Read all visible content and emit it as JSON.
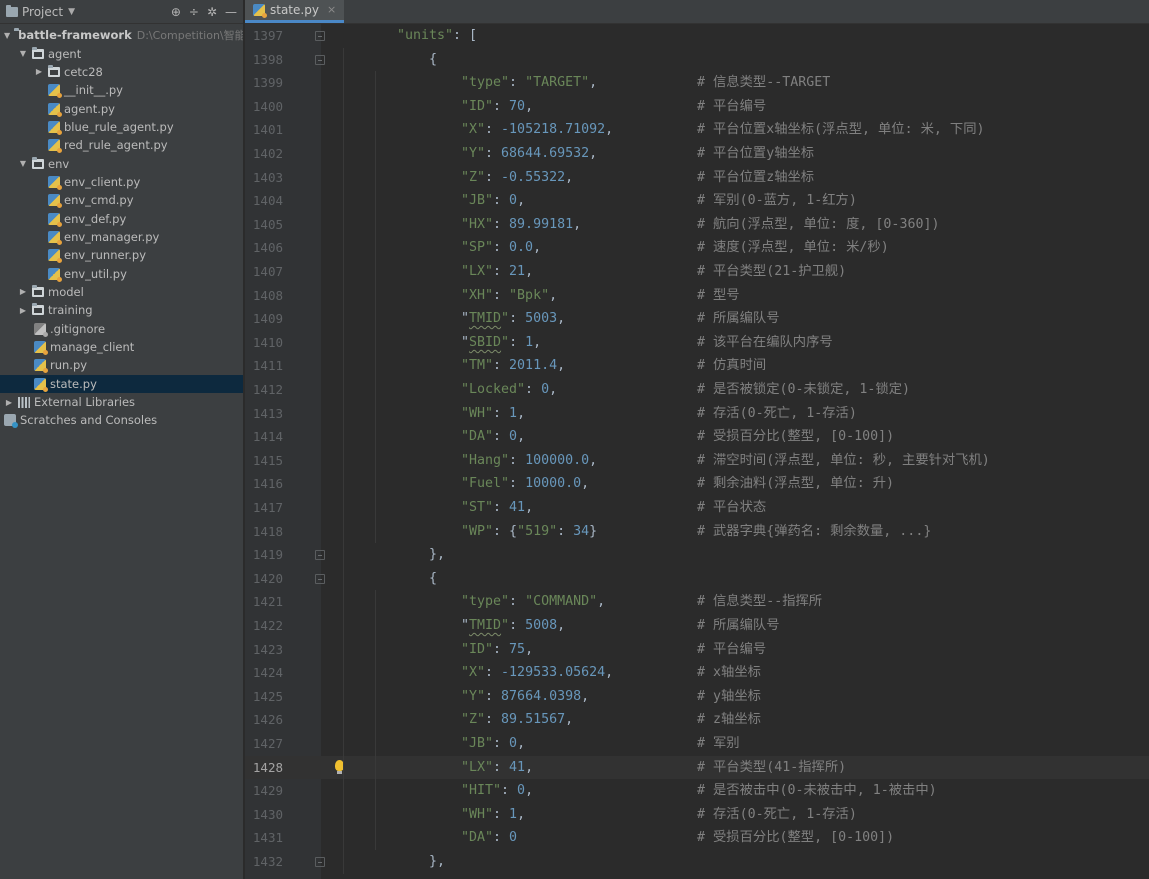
{
  "project_panel": {
    "title": "Project",
    "header_icons": [
      "locate-icon",
      "collapse-icon",
      "settings-icon",
      "hide-icon"
    ],
    "tree": [
      {
        "label": "battle-framework",
        "path": "D:\\Competition\\智能体",
        "depth": 0,
        "type": "folder-root",
        "expanded": true
      },
      {
        "label": "agent",
        "depth": 1,
        "type": "folder",
        "expanded": true
      },
      {
        "label": "cetc28",
        "depth": 2,
        "type": "folder",
        "expanded": false
      },
      {
        "label": "__init__.py",
        "depth": 3,
        "type": "py"
      },
      {
        "label": "agent.py",
        "depth": 3,
        "type": "py"
      },
      {
        "label": "blue_rule_agent.py",
        "depth": 3,
        "type": "py"
      },
      {
        "label": "red_rule_agent.py",
        "depth": 3,
        "type": "py"
      },
      {
        "label": "env",
        "depth": 1,
        "type": "folder",
        "expanded": true
      },
      {
        "label": "env_client.py",
        "depth": 3,
        "type": "py"
      },
      {
        "label": "env_cmd.py",
        "depth": 3,
        "type": "py"
      },
      {
        "label": "env_def.py",
        "depth": 3,
        "type": "py"
      },
      {
        "label": "env_manager.py",
        "depth": 3,
        "type": "py"
      },
      {
        "label": "env_runner.py",
        "depth": 3,
        "type": "py"
      },
      {
        "label": "env_util.py",
        "depth": 3,
        "type": "py"
      },
      {
        "label": "model",
        "depth": 1,
        "type": "folder",
        "expanded": false
      },
      {
        "label": "training",
        "depth": 1,
        "type": "folder",
        "expanded": false
      },
      {
        "label": ".gitignore",
        "depth": 2,
        "type": "file"
      },
      {
        "label": "manage_client",
        "depth": 2,
        "type": "file"
      },
      {
        "label": "run.py",
        "depth": 2,
        "type": "py"
      },
      {
        "label": "state.py",
        "depth": 2,
        "type": "py",
        "selected": true
      },
      {
        "label": "External Libraries",
        "depth": 0,
        "type": "lib",
        "expanded": false
      },
      {
        "label": "Scratches and Consoles",
        "depth": 0,
        "type": "scratch"
      }
    ]
  },
  "editor": {
    "tab": {
      "label": "state.py",
      "close": "×"
    },
    "current_line": 1428,
    "lines": [
      {
        "n": 1397,
        "indent": 3,
        "fold": true,
        "parts": [
          [
            "key",
            "\"units\""
          ],
          [
            "p",
            ": ["
          ]
        ]
      },
      {
        "n": 1398,
        "indent": 4,
        "fold": true,
        "parts": [
          [
            "p",
            "{"
          ]
        ]
      },
      {
        "n": 1399,
        "indent": 5,
        "parts": [
          [
            "key",
            "\"type\""
          ],
          [
            "p",
            ": "
          ],
          [
            "str",
            "\"TARGET\""
          ],
          [
            "p",
            ","
          ]
        ],
        "comment": "# 信息类型--TARGET"
      },
      {
        "n": 1400,
        "indent": 5,
        "parts": [
          [
            "key",
            "\"ID\""
          ],
          [
            "p",
            ": "
          ],
          [
            "num",
            "70"
          ],
          [
            "p",
            ","
          ]
        ],
        "comment": "# 平台编号"
      },
      {
        "n": 1401,
        "indent": 5,
        "parts": [
          [
            "key",
            "\"X\""
          ],
          [
            "p",
            ": "
          ],
          [
            "num",
            "-105218.71092"
          ],
          [
            "p",
            ","
          ]
        ],
        "comment": "# 平台位置x轴坐标(浮点型, 单位: 米, 下同)"
      },
      {
        "n": 1402,
        "indent": 5,
        "parts": [
          [
            "key",
            "\"Y\""
          ],
          [
            "p",
            ": "
          ],
          [
            "num",
            "68644.69532"
          ],
          [
            "p",
            ","
          ]
        ],
        "comment": "# 平台位置y轴坐标"
      },
      {
        "n": 1403,
        "indent": 5,
        "parts": [
          [
            "key",
            "\"Z\""
          ],
          [
            "p",
            ": "
          ],
          [
            "num",
            "-0.55322"
          ],
          [
            "p",
            ","
          ]
        ],
        "comment": "# 平台位置z轴坐标"
      },
      {
        "n": 1404,
        "indent": 5,
        "parts": [
          [
            "key",
            "\"JB\""
          ],
          [
            "p",
            ": "
          ],
          [
            "num",
            "0"
          ],
          [
            "p",
            ","
          ]
        ],
        "comment": "# 军别(0-蓝方, 1-红方)"
      },
      {
        "n": 1405,
        "indent": 5,
        "parts": [
          [
            "key",
            "\"HX\""
          ],
          [
            "p",
            ": "
          ],
          [
            "num",
            "89.99181"
          ],
          [
            "p",
            ","
          ]
        ],
        "comment": "# 航向(浮点型, 单位: 度, [0-360])"
      },
      {
        "n": 1406,
        "indent": 5,
        "parts": [
          [
            "key",
            "\"SP\""
          ],
          [
            "p",
            ": "
          ],
          [
            "num",
            "0.0"
          ],
          [
            "p",
            ","
          ]
        ],
        "comment": "# 速度(浮点型, 单位: 米/秒)"
      },
      {
        "n": 1407,
        "indent": 5,
        "parts": [
          [
            "key",
            "\"LX\""
          ],
          [
            "p",
            ": "
          ],
          [
            "num",
            "21"
          ],
          [
            "p",
            ","
          ]
        ],
        "comment": "# 平台类型(21-护卫舰)"
      },
      {
        "n": 1408,
        "indent": 5,
        "parts": [
          [
            "key",
            "\"XH\""
          ],
          [
            "p",
            ": "
          ],
          [
            "str",
            "\"Bpk\""
          ],
          [
            "p",
            ","
          ]
        ],
        "comment": "# 型号"
      },
      {
        "n": 1409,
        "indent": 5,
        "parts": [
          [
            "p",
            "\""
          ],
          [
            "keysq",
            "TMID"
          ],
          [
            "key",
            "\""
          ],
          [
            "p",
            ": "
          ],
          [
            "num",
            "5003"
          ],
          [
            "p",
            ","
          ]
        ],
        "comment": "# 所属编队号"
      },
      {
        "n": 1410,
        "indent": 5,
        "parts": [
          [
            "p",
            "\""
          ],
          [
            "keysq",
            "SBID"
          ],
          [
            "key",
            "\""
          ],
          [
            "p",
            ": "
          ],
          [
            "num",
            "1"
          ],
          [
            "p",
            ","
          ]
        ],
        "comment": "# 该平台在编队内序号"
      },
      {
        "n": 1411,
        "indent": 5,
        "parts": [
          [
            "key",
            "\"TM\""
          ],
          [
            "p",
            ": "
          ],
          [
            "num",
            "2011.4"
          ],
          [
            "p",
            ","
          ]
        ],
        "comment": "# 仿真时间"
      },
      {
        "n": 1412,
        "indent": 5,
        "parts": [
          [
            "key",
            "\"Locked\""
          ],
          [
            "p",
            ": "
          ],
          [
            "num",
            "0"
          ],
          [
            "p",
            ","
          ]
        ],
        "comment": "# 是否被锁定(0-未锁定, 1-锁定)"
      },
      {
        "n": 1413,
        "indent": 5,
        "parts": [
          [
            "key",
            "\"WH\""
          ],
          [
            "p",
            ": "
          ],
          [
            "num",
            "1"
          ],
          [
            "p",
            ","
          ]
        ],
        "comment": "# 存活(0-死亡, 1-存活)"
      },
      {
        "n": 1414,
        "indent": 5,
        "parts": [
          [
            "key",
            "\"DA\""
          ],
          [
            "p",
            ": "
          ],
          [
            "num",
            "0"
          ],
          [
            "p",
            ","
          ]
        ],
        "comment": "# 受损百分比(整型, [0-100])"
      },
      {
        "n": 1415,
        "indent": 5,
        "parts": [
          [
            "key",
            "\"Hang\""
          ],
          [
            "p",
            ": "
          ],
          [
            "num",
            "100000.0"
          ],
          [
            "p",
            ","
          ]
        ],
        "comment": "# 滞空时间(浮点型, 单位: 秒, 主要针对飞机)"
      },
      {
        "n": 1416,
        "indent": 5,
        "parts": [
          [
            "key",
            "\"Fuel\""
          ],
          [
            "p",
            ": "
          ],
          [
            "num",
            "10000.0"
          ],
          [
            "p",
            ","
          ]
        ],
        "comment": "# 剩余油料(浮点型, 单位: 升)"
      },
      {
        "n": 1417,
        "indent": 5,
        "parts": [
          [
            "key",
            "\"ST\""
          ],
          [
            "p",
            ": "
          ],
          [
            "num",
            "41"
          ],
          [
            "p",
            ","
          ]
        ],
        "comment": "# 平台状态"
      },
      {
        "n": 1418,
        "indent": 5,
        "parts": [
          [
            "key",
            "\"WP\""
          ],
          [
            "p",
            ": {"
          ],
          [
            "str",
            "\"519\""
          ],
          [
            "p",
            ": "
          ],
          [
            "num",
            "34"
          ],
          [
            "p",
            "}"
          ]
        ],
        "comment": "# 武器字典{弹药名: 剩余数量, ...}"
      },
      {
        "n": 1419,
        "indent": 4,
        "fold": true,
        "parts": [
          [
            "p",
            "},"
          ]
        ]
      },
      {
        "n": 1420,
        "indent": 4,
        "fold": true,
        "parts": [
          [
            "p",
            "{"
          ]
        ]
      },
      {
        "n": 1421,
        "indent": 5,
        "parts": [
          [
            "key",
            "\"type\""
          ],
          [
            "p",
            ": "
          ],
          [
            "str",
            "\"COMMAND\""
          ],
          [
            "p",
            ","
          ]
        ],
        "comment": "# 信息类型--指挥所"
      },
      {
        "n": 1422,
        "indent": 5,
        "parts": [
          [
            "p",
            "\""
          ],
          [
            "keysq",
            "TMID"
          ],
          [
            "key",
            "\""
          ],
          [
            "p",
            ": "
          ],
          [
            "num",
            "5008"
          ],
          [
            "p",
            ","
          ]
        ],
        "comment": "# 所属编队号"
      },
      {
        "n": 1423,
        "indent": 5,
        "parts": [
          [
            "key",
            "\"ID\""
          ],
          [
            "p",
            ": "
          ],
          [
            "num",
            "75"
          ],
          [
            "p",
            ","
          ]
        ],
        "comment": "# 平台编号"
      },
      {
        "n": 1424,
        "indent": 5,
        "parts": [
          [
            "key",
            "\"X\""
          ],
          [
            "p",
            ": "
          ],
          [
            "num",
            "-129533.05624"
          ],
          [
            "p",
            ","
          ]
        ],
        "comment": "# x轴坐标"
      },
      {
        "n": 1425,
        "indent": 5,
        "parts": [
          [
            "key",
            "\"Y\""
          ],
          [
            "p",
            ": "
          ],
          [
            "num",
            "87664.0398"
          ],
          [
            "p",
            ","
          ]
        ],
        "comment": "# y轴坐标"
      },
      {
        "n": 1426,
        "indent": 5,
        "parts": [
          [
            "key",
            "\"Z\""
          ],
          [
            "p",
            ": "
          ],
          [
            "num",
            "89.51567"
          ],
          [
            "p",
            ","
          ]
        ],
        "comment": "# z轴坐标"
      },
      {
        "n": 1427,
        "indent": 5,
        "parts": [
          [
            "key",
            "\"JB\""
          ],
          [
            "p",
            ": "
          ],
          [
            "num",
            "0"
          ],
          [
            "p",
            ","
          ]
        ],
        "comment": "# 军别"
      },
      {
        "n": 1428,
        "indent": 5,
        "bulb": true,
        "parts": [
          [
            "key",
            "\"LX\""
          ],
          [
            "p",
            ": "
          ],
          [
            "num",
            "41"
          ],
          [
            "p",
            ","
          ]
        ],
        "comment": "# 平台类型(41-指挥所)"
      },
      {
        "n": 1429,
        "indent": 5,
        "parts": [
          [
            "key",
            "\"HIT\""
          ],
          [
            "p",
            ": "
          ],
          [
            "num",
            "0"
          ],
          [
            "p",
            ","
          ]
        ],
        "comment": "# 是否被击中(0-未被击中, 1-被击中)"
      },
      {
        "n": 1430,
        "indent": 5,
        "parts": [
          [
            "key",
            "\"WH\""
          ],
          [
            "p",
            ": "
          ],
          [
            "num",
            "1"
          ],
          [
            "p",
            ","
          ]
        ],
        "comment": "# 存活(0-死亡, 1-存活)"
      },
      {
        "n": 1431,
        "indent": 5,
        "parts": [
          [
            "key",
            "\"DA\""
          ],
          [
            "p",
            ": "
          ],
          [
            "num",
            "0"
          ]
        ],
        "comment": "# 受损百分比(整型, [0-100])"
      },
      {
        "n": 1432,
        "indent": 4,
        "fold": true,
        "parts": [
          [
            "p",
            "},"
          ]
        ]
      }
    ]
  }
}
